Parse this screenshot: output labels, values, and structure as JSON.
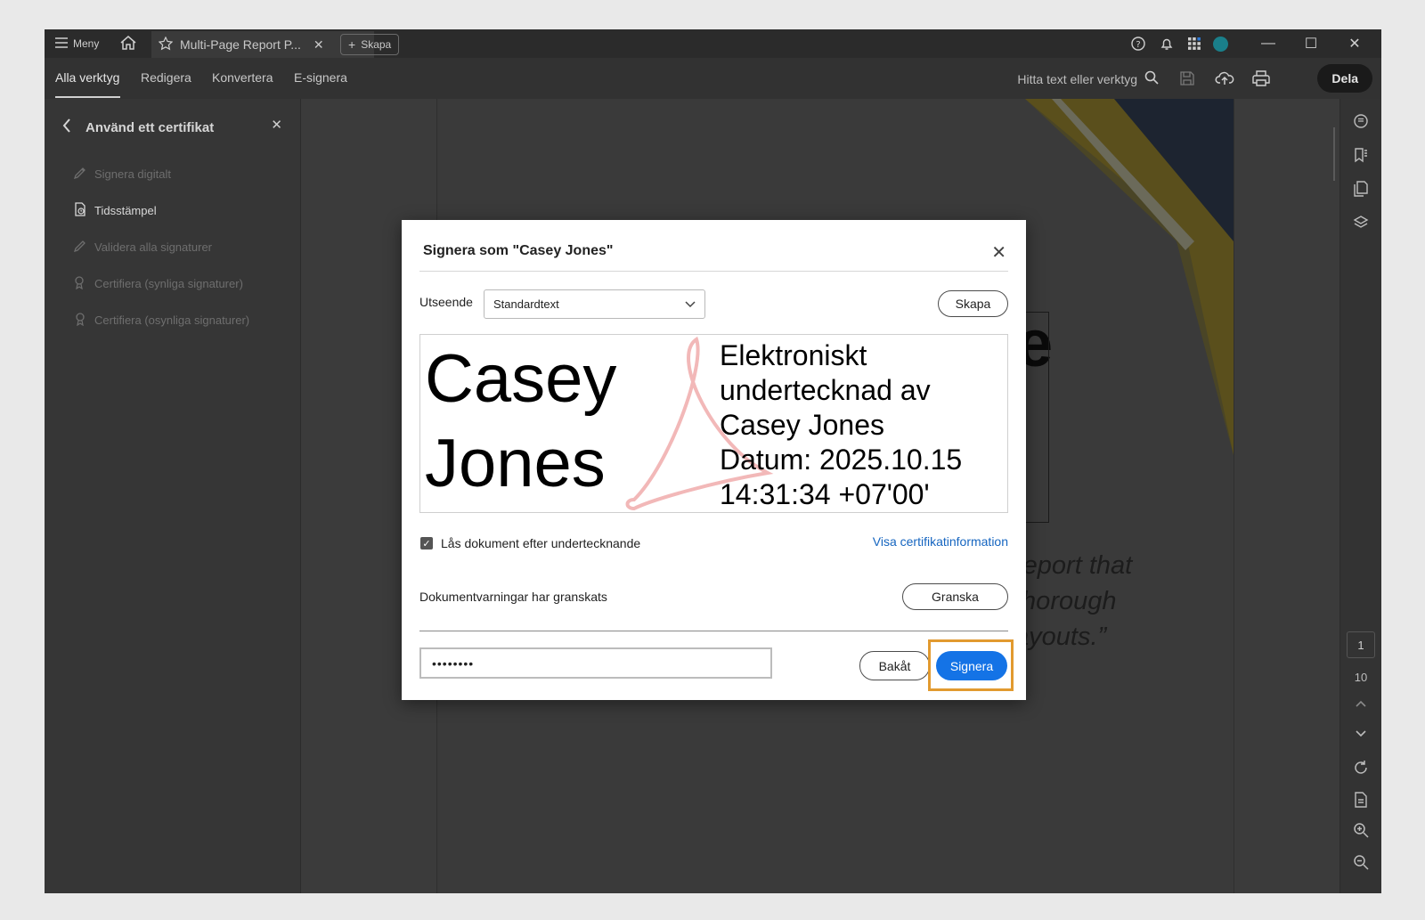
{
  "titlebar": {
    "menu_label": "Meny",
    "tab_title": "Multi-Page Report P...",
    "new_tab_label": "Skapa"
  },
  "toolbar": {
    "tabs": [
      "Alla verktyg",
      "Redigera",
      "Konvertera",
      "E-signera"
    ],
    "search_placeholder": "Hitta text eller verktyg",
    "share_label": "Dela"
  },
  "left_panel": {
    "title": "Använd ett certifikat",
    "items": [
      {
        "label": "Signera digitalt",
        "enabled": false
      },
      {
        "label": "Tidsstämpel",
        "enabled": true
      },
      {
        "label": "Validera alla signaturer",
        "enabled": false
      },
      {
        "label": "Certifiera (synliga signaturer)",
        "enabled": false
      },
      {
        "label": "Certifiera (osynliga signaturer)",
        "enabled": false
      }
    ]
  },
  "document": {
    "big_letter": "e",
    "quote_lines": [
      "report that",
      "thorough",
      "ayouts.”"
    ]
  },
  "right_rail": {
    "current_page": "1",
    "page_count": "10"
  },
  "dialog": {
    "title": "Signera som \"Casey Jones\"",
    "appearance_label": "Utseende",
    "appearance_value": "Standardtext",
    "create_button": "Skapa",
    "signature_name_line1": "Casey",
    "signature_name_line2": "Jones",
    "signature_info": [
      "Elektroniskt",
      "undertecknad av",
      "Casey Jones",
      "Datum: 2025.10.15",
      "14:31:34 +07'00'"
    ],
    "lock_checkbox_label": "Lås dokument efter undertecknande",
    "lock_checked": true,
    "cert_info_link": "Visa certifikatinformation",
    "warnings_label": "Dokumentvarningar har granskats",
    "review_button": "Granska",
    "password_value": "••••••••",
    "back_button": "Bakåt",
    "sign_button": "Signera"
  },
  "colors": {
    "accent_blue": "#1473e6",
    "highlight_orange": "#e29a2f",
    "link_blue": "#1565c0"
  }
}
